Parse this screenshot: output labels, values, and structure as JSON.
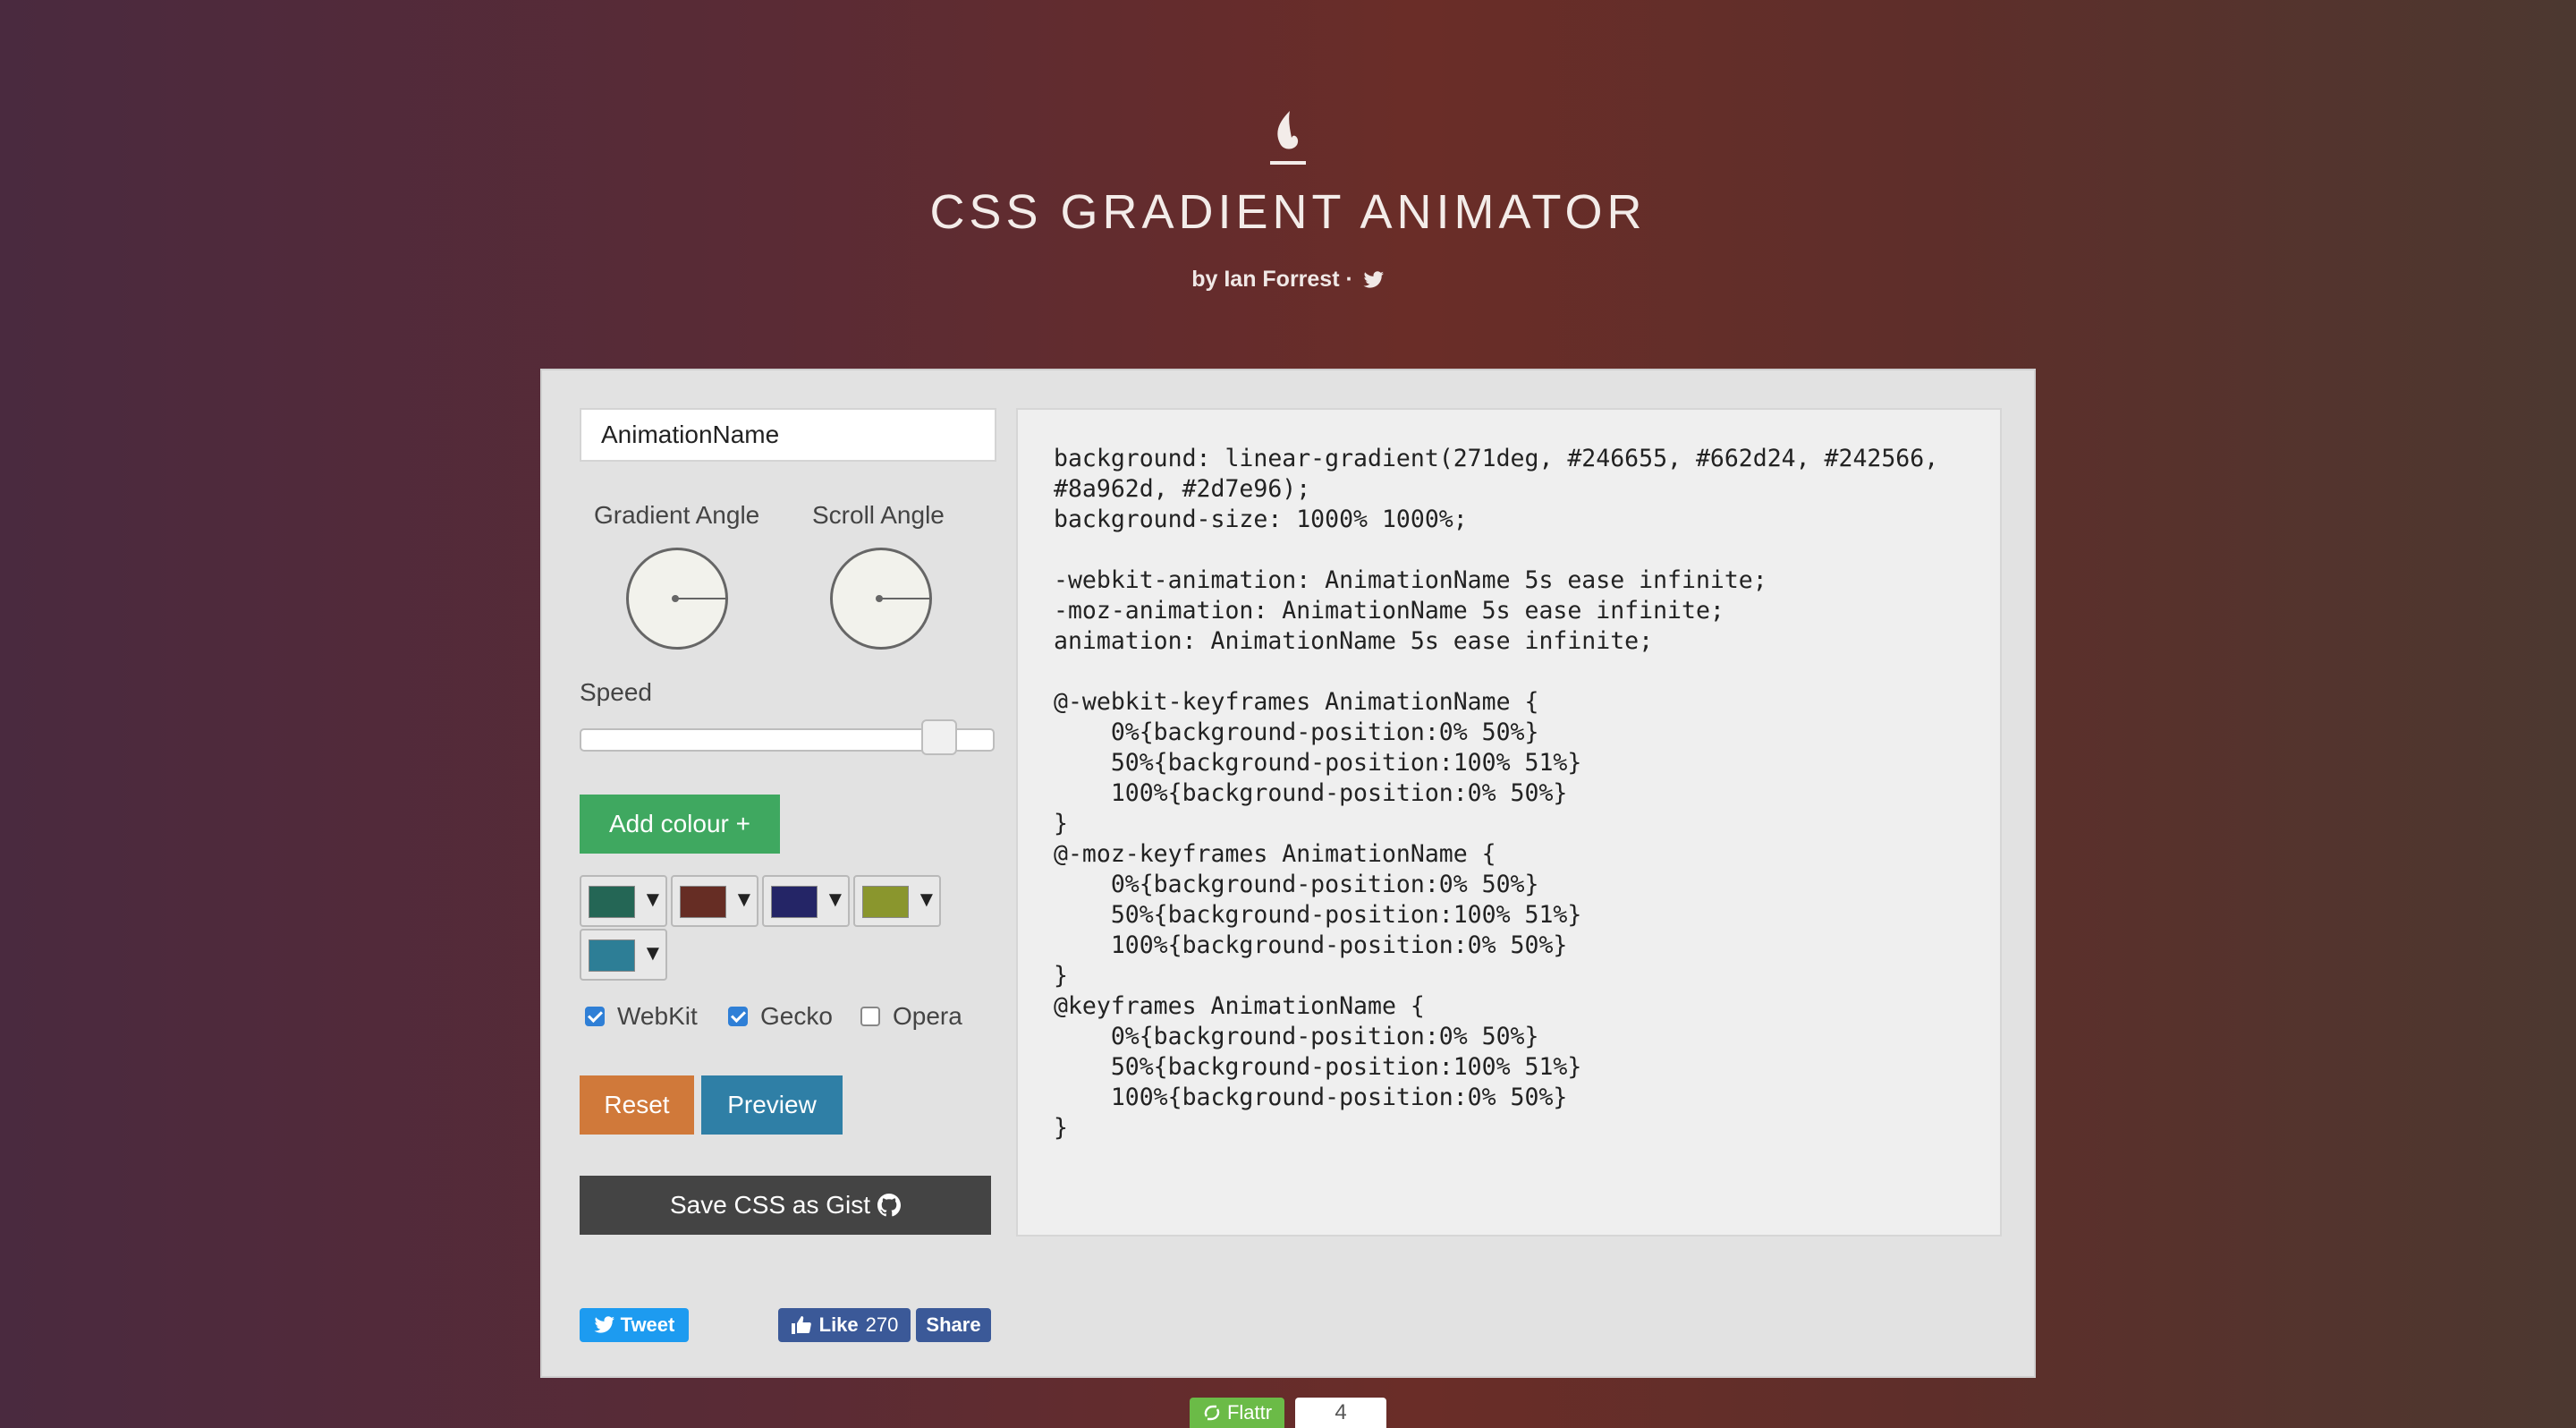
{
  "header": {
    "title": "CSS GRADIENT ANIMATOR",
    "byline": "by Ian Forrest ·",
    "logo_icon": "flame-logo-icon"
  },
  "controls": {
    "animation_name_value": "AnimationName",
    "gradient_angle_label": "Gradient Angle",
    "scroll_angle_label": "Scroll Angle",
    "speed_label": "Speed",
    "speed_fraction": 0.9,
    "add_colour_label": "Add colour +",
    "colours": [
      "#246655",
      "#662d24",
      "#242566",
      "#8a962d",
      "#2d7e96"
    ],
    "dropdown_arrow": "▼",
    "checkboxes": [
      {
        "label": "WebKit",
        "checked": true
      },
      {
        "label": "Gecko",
        "checked": true
      },
      {
        "label": "Opera",
        "checked": false
      }
    ],
    "reset_label": "Reset",
    "preview_label": "Preview",
    "gist_label": "Save CSS as Gist"
  },
  "code_output": "background: linear-gradient(271deg, #246655, #662d24, #242566,\n#8a962d, #2d7e96);\nbackground-size: 1000% 1000%;\n\n-webkit-animation: AnimationName 5s ease infinite;\n-moz-animation: AnimationName 5s ease infinite;\nanimation: AnimationName 5s ease infinite;\n\n@-webkit-keyframes AnimationName {\n    0%{background-position:0% 50%}\n    50%{background-position:100% 51%}\n    100%{background-position:0% 50%}\n}\n@-moz-keyframes AnimationName {\n    0%{background-position:0% 50%}\n    50%{background-position:100% 51%}\n    100%{background-position:0% 50%}\n}\n@keyframes AnimationName {\n    0%{background-position:0% 50%}\n    50%{background-position:100% 51%}\n    100%{background-position:0% 50%}\n}",
  "social": {
    "tweet_label": "Tweet",
    "like_label": "Like",
    "like_count": "270",
    "share_label": "Share",
    "flattr_label": "Flattr",
    "flattr_count": "4"
  },
  "colors": {
    "add_button": "#3fa860",
    "reset_button": "#d0793a",
    "preview_button": "#2f7fa6",
    "gist_button": "#444444",
    "twitter": "#1d9bf0",
    "facebook": "#3b5998",
    "flattr": "#6bbb47"
  }
}
